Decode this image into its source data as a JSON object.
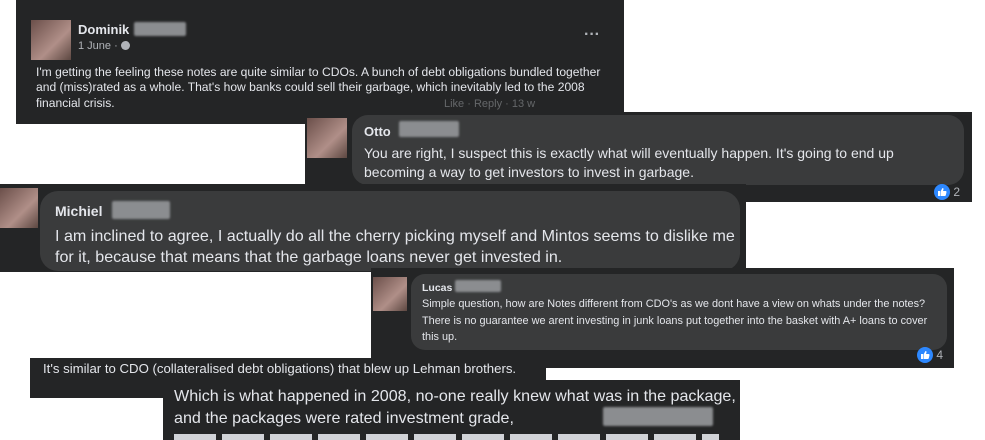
{
  "comments": {
    "dominik": {
      "name": "Dominik",
      "time": "1 June · ",
      "more": "···",
      "text": "I'm getting the feeling these notes are quite similar to CDOs. A bunch of debt obligations bundled together and (miss)rated as a whole. That's how banks could sell their garbage, which inevitably led to the 2008 financial crisis.",
      "hidden_actions": "Like · Reply · 13 w"
    },
    "otto": {
      "name": "Otto",
      "text": "You are right, I suspect this is exactly what will eventually happen. It's going to end up becoming a way to get investors to invest in garbage.",
      "reactions": "2"
    },
    "michiel": {
      "name": "Michiel",
      "text": "I am inclined to agree, I actually do all the cherry picking myself and Mintos seems to dislike me for it, because that means that the garbage loans never get invested in."
    },
    "lucas": {
      "name": "Lucas",
      "text": "Simple question, how are Notes different from CDO's as we dont have a view on whats under the notes? There is no guarantee we arent investing in junk loans put together into the basket with A+ loans to cover this up.",
      "reactions": "4"
    },
    "cdo_comment": {
      "text": "It's similar to CDO (collateralised debt obligations) that blew up Lehman brothers."
    },
    "last_comment": {
      "text": "Which is what happened in 2008, no-one really knew what was in the package, and the packages were rated investment grade,"
    }
  },
  "colors": {
    "dark_bg": "#242526",
    "bubble_bg": "#3a3b3c",
    "text": "#e4e6eb",
    "muted": "#b0b3b8",
    "like_blue": "#2d88ff"
  },
  "icons": {
    "like": "thumbs-up-icon",
    "globe": "globe-icon",
    "more": "more-options-icon"
  }
}
